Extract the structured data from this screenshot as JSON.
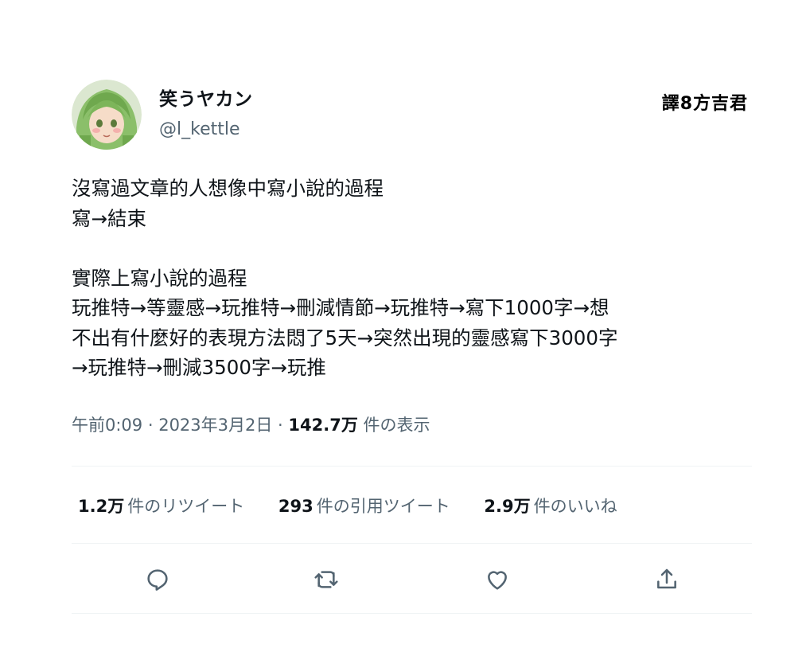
{
  "author": {
    "display_name": "笑うヤカン",
    "handle": "@l_kettle"
  },
  "watermark": "譯8方吉君",
  "tweet": {
    "lines": [
      "沒寫過文章的人想像中寫小說的過程",
      "寫→結束",
      "",
      "實際上寫小說的過程",
      "玩推特→等靈感→玩推特→刪減情節→玩推特→寫下1000字→想",
      "不出有什麼好的表現方法悶了5天→突然出現的靈感寫下3000字",
      "→玩推特→刪減3500字→玩推"
    ]
  },
  "meta": {
    "time": "午前0:09",
    "sep1": " · ",
    "date": "2023年3月2日",
    "sep2": " · ",
    "views_count": "142.7万",
    "views_label": " 件の表示"
  },
  "stats": [
    {
      "count": "1.2万",
      "label": "件のリツイート"
    },
    {
      "count": "293",
      "label": "件の引用ツイート"
    },
    {
      "count": "2.9万",
      "label": "件のいいね"
    }
  ],
  "actions": [
    {
      "icon": "reply-icon"
    },
    {
      "icon": "retweet-icon"
    },
    {
      "icon": "like-icon"
    },
    {
      "icon": "share-icon"
    }
  ],
  "colors": {
    "text": "#0f1419",
    "secondary": "#536471",
    "divider": "#eff3f4"
  }
}
